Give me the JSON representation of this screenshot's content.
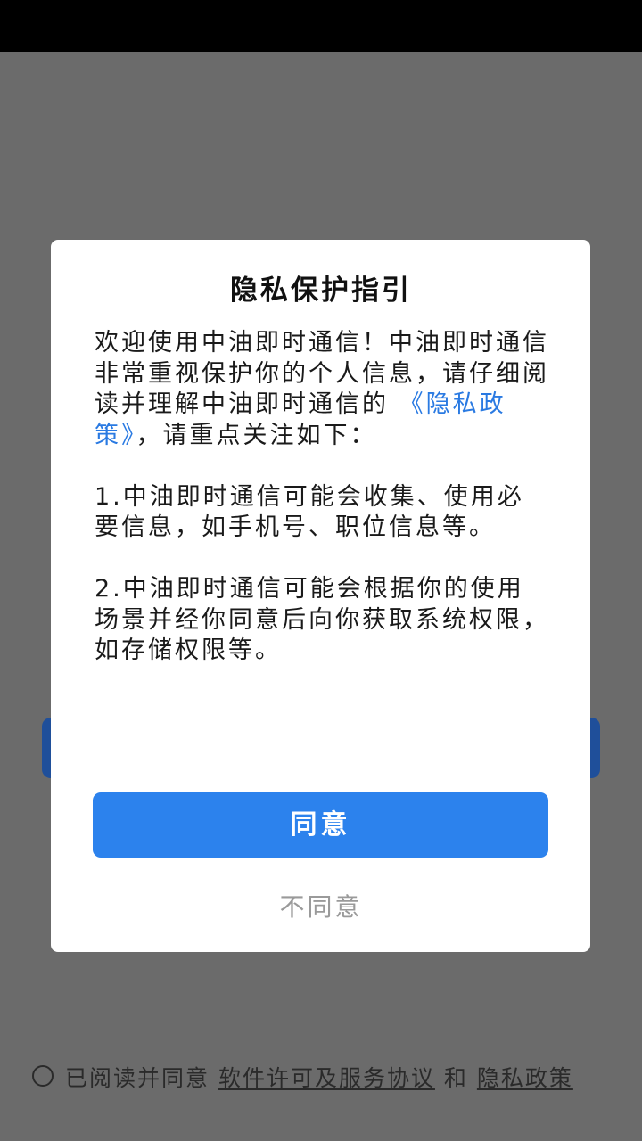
{
  "dialog": {
    "title": "隐私保护指引",
    "intro_before_link": "欢迎使用中油即时通信！中油即时通信非常重视保护你的个人信息，请仔细阅读并理解中油即时通信的 ",
    "policy_link": "《隐私政策》",
    "intro_after_link": "，请重点关注如下：",
    "point1": "1.中油即时通信可能会收集、使用必要信息，如手机号、职位信息等。",
    "point2": "2.中油即时通信可能会根据你的使用场景并经你同意后向你获取系统权限，如存储权限等。",
    "agree_label": "同意",
    "disagree_label": "不同意"
  },
  "consent": {
    "prefix": "已阅读并同意 ",
    "license_link": "软件许可及服务协议",
    "and_text": " 和 ",
    "privacy_link": "隐私政策"
  },
  "colors": {
    "accent": "#2c82ed",
    "link": "#2a7ae2",
    "overlay": "#6b6b6b"
  }
}
